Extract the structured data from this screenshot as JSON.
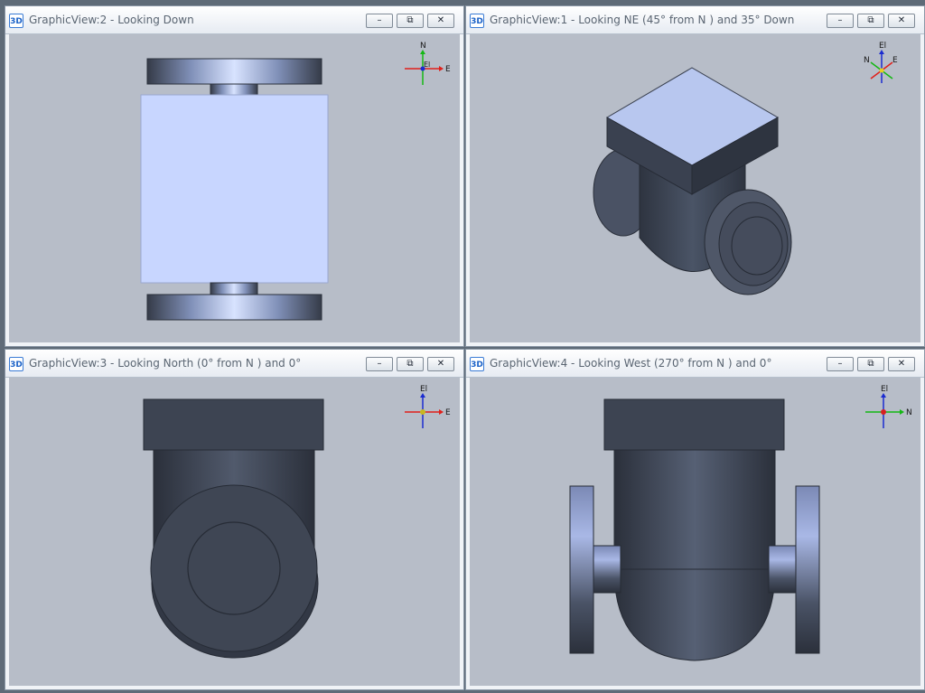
{
  "views": [
    {
      "id": "top-left",
      "title": "GraphicView:2 - Looking Down",
      "app_icon_text": "3D",
      "triad": {
        "up": "N",
        "right": "E",
        "center": "El"
      }
    },
    {
      "id": "top-right",
      "title": "GraphicView:1 - Looking NE (45° from N ) and 35° Down",
      "app_icon_text": "3D",
      "triad": {
        "up": "El",
        "left": "N",
        "right": "E"
      }
    },
    {
      "id": "bottom-left",
      "title": "GraphicView:3 - Looking North (0° from N ) and 0°",
      "app_icon_text": "3D",
      "triad": {
        "up": "El",
        "right": "E"
      }
    },
    {
      "id": "bottom-right",
      "title": "GraphicView:4 - Looking West (270° from N ) and 0°",
      "app_icon_text": "3D",
      "triad": {
        "up": "El",
        "right": "N"
      }
    }
  ],
  "window_buttons": {
    "minimize": "–",
    "restore": "⧉",
    "close": "✕"
  },
  "colors": {
    "viewport_bg": "#b7bdc8",
    "model_dark": "#3d4452",
    "model_light": "#c8d6ff",
    "axis_red": "#e0201b",
    "axis_green": "#14b814",
    "axis_blue": "#1a2bd0"
  }
}
